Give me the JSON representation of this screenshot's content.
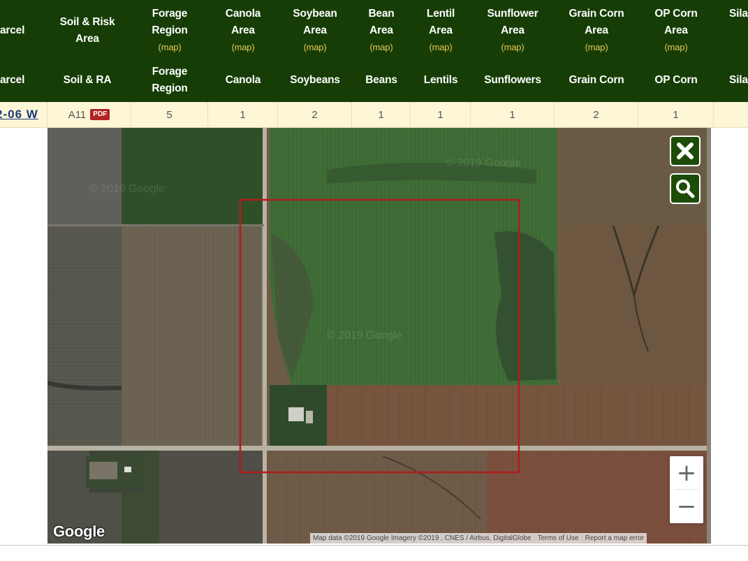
{
  "header": {
    "row1": {
      "parcel": "arcel",
      "soil_risk": [
        "Soil & Risk",
        "Area"
      ],
      "forage": [
        "Forage",
        "Region"
      ],
      "canola": [
        "Canola",
        "Area"
      ],
      "soybean": [
        "Soybean",
        "Area"
      ],
      "bean": [
        "Bean",
        "Area"
      ],
      "lentil": [
        "Lentil",
        "Area"
      ],
      "sunflower": [
        "Sunflower",
        "Area"
      ],
      "grain_corn": [
        "Grain Corn",
        "Area"
      ],
      "op_corn": [
        "OP Corn",
        "Area"
      ],
      "silage": "Sila",
      "map_link": "(map)"
    },
    "row2": {
      "parcel": "arcel",
      "soil_ra": "Soil & RA",
      "forage": [
        "Forage",
        "Region"
      ],
      "canola": "Canola",
      "soybeans": "Soybeans",
      "beans": "Beans",
      "lentils": "Lentils",
      "sunflowers": "Sunflowers",
      "grain_corn": "Grain Corn",
      "op_corn": "OP Corn",
      "silage": "Sila"
    }
  },
  "row": {
    "parcel": "2-06 W",
    "soil": "A11",
    "pdf_label": "PDF",
    "forage": "5",
    "canola": "1",
    "soybeans": "2",
    "beans": "1",
    "lentils": "1",
    "sunflowers": "1",
    "grain_corn": "2",
    "op_corn": "1"
  },
  "map": {
    "logo": "Google",
    "watermarks": [
      "© 2019 Google",
      "© 2019 Google",
      "© 2019 Google"
    ],
    "attribution": "Map data ©2019 Google Imagery ©2019 , CNES / Airbus, DigitalGlobe",
    "terms": "Terms of Use",
    "report": "Report a map error",
    "zoom_in": "+",
    "zoom_out": "−"
  },
  "colors": {
    "header_bg": "#153d05",
    "map_link": "#e9c75a",
    "row_bg": "#fdf6d7",
    "parcel_box": "#b01d1d",
    "button_bg": "#1c4c08"
  }
}
